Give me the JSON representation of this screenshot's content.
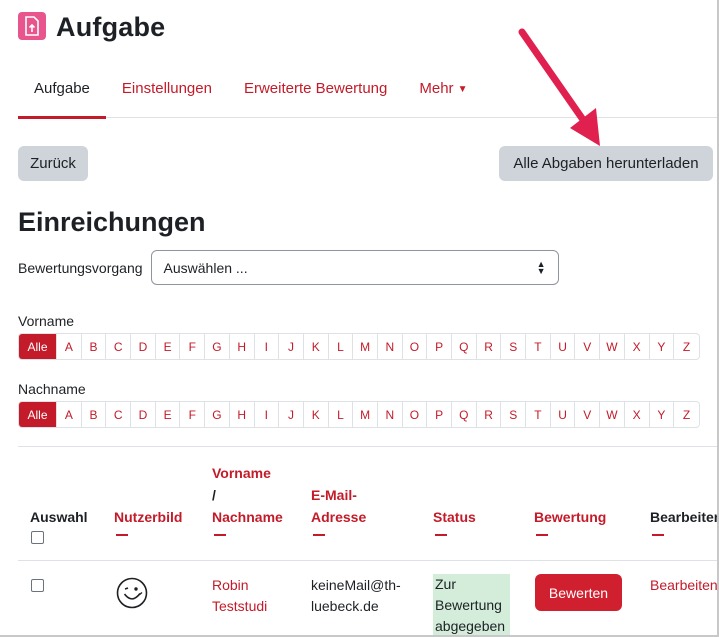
{
  "page": {
    "title": "Aufgabe"
  },
  "nav": {
    "items": [
      {
        "label": "Aufgabe"
      },
      {
        "label": "Einstellungen"
      },
      {
        "label": "Erweiterte Bewertung"
      },
      {
        "label": "Mehr"
      }
    ]
  },
  "actions": {
    "back_label": "Zurück",
    "download_label": "Alle Abgaben herunterladen"
  },
  "section": {
    "title": "Einreichungen"
  },
  "grading": {
    "label": "Bewertungsvorgang",
    "selected": "Auswählen ..."
  },
  "filters": {
    "firstname_label": "Vorname",
    "lastname_label": "Nachname",
    "letters": [
      "Alle",
      "A",
      "B",
      "C",
      "D",
      "E",
      "F",
      "G",
      "H",
      "I",
      "J",
      "K",
      "L",
      "M",
      "N",
      "O",
      "P",
      "Q",
      "R",
      "S",
      "T",
      "U",
      "V",
      "W",
      "X",
      "Y",
      "Z"
    ]
  },
  "table": {
    "headers": {
      "select": "Auswahl",
      "picture": "Nutzerbild",
      "name_line1": "Vorname",
      "name_line2": "/",
      "name_line3": "Nachname",
      "email_line1": "E-Mail-",
      "email_line2": "Adresse",
      "status": "Status",
      "grade": "Bewertung",
      "edit": "Bearbeiten"
    },
    "rows": [
      {
        "firstname": "Robin",
        "lastname": "Teststudi",
        "email_line1": "keineMail@th-",
        "email_line2": "luebeck.de",
        "status_line1": "Zur",
        "status_line2": "Bewertung",
        "status_line3": "abgegeben",
        "grade_button": "Bewerten",
        "edit_link": "Bearbeiten"
      }
    ]
  },
  "colors": {
    "accent": "#c31b29",
    "button_primary": "#d01f2e",
    "icon_bg": "#e8548c",
    "status_bg": "#d4edda",
    "annotation_arrow": "#e0204f"
  }
}
